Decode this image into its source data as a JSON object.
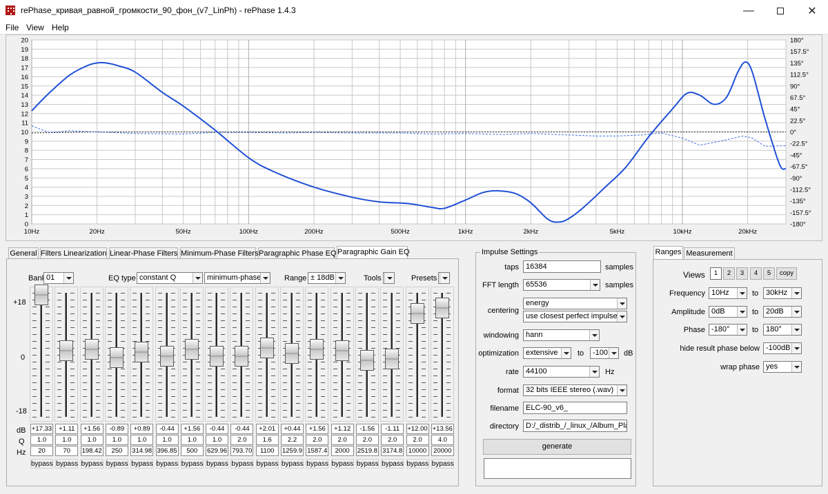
{
  "window": {
    "title": "rePhase_кривая_равной_громкости_90_фон_(v7_LinPh)  -  rePhase 1.4.3",
    "minimize_icon": "minimize-icon",
    "maximize_icon": "maximize-icon",
    "close_icon": "close-icon"
  },
  "menu": [
    "File",
    "View",
    "Help"
  ],
  "plot": {
    "y_left_ticks": [
      "20",
      "19",
      "18",
      "17",
      "16",
      "15",
      "14",
      "13",
      "12",
      "11",
      "10",
      "9",
      "8",
      "7",
      "6",
      "5",
      "4",
      "3",
      "2",
      "1",
      "0"
    ],
    "y_right_ticks": [
      "180°",
      "157.5°",
      "135°",
      "112.5°",
      "90°",
      "67.5°",
      "45°",
      "22.5°",
      "0°",
      "-22.5°",
      "-45°",
      "-67.5°",
      "-90°",
      "-112.5°",
      "-135°",
      "-157.5°",
      "-180°"
    ],
    "x_labels": [
      "10Hz",
      "20Hz",
      "50Hz",
      "100Hz",
      "200Hz",
      "500Hz",
      "1kHz",
      "2kHz",
      "5kHz",
      "10kHz",
      "20kHz"
    ],
    "colors": {
      "curve": "#1f4fd6",
      "phase": "#3d6fe0",
      "grid": "#c8c8c8",
      "background": "#ffffff"
    }
  },
  "chart_data": {
    "type": "line",
    "x_scale": "log",
    "xlim_hz": [
      10,
      30000
    ],
    "ylim_db": [
      0,
      20
    ],
    "y2lim_deg": [
      -180,
      180
    ],
    "series": [
      {
        "values_hz_db": [
          [
            10,
            12.3
          ],
          [
            12,
            14.2
          ],
          [
            15,
            16.2
          ],
          [
            18,
            17.2
          ],
          [
            20,
            17.5
          ],
          [
            22,
            17.5
          ],
          [
            25,
            17.2
          ],
          [
            30,
            16.5
          ],
          [
            40,
            14.3
          ],
          [
            50,
            12.8
          ],
          [
            70,
            10.2
          ],
          [
            100,
            7.2
          ],
          [
            130,
            5.7
          ],
          [
            200,
            4.0
          ],
          [
            300,
            2.9
          ],
          [
            400,
            2.4
          ],
          [
            550,
            2.2
          ],
          [
            700,
            1.8
          ],
          [
            800,
            1.7
          ],
          [
            1000,
            2.6
          ],
          [
            1200,
            3.4
          ],
          [
            1400,
            3.6
          ],
          [
            1700,
            3.3
          ],
          [
            2000,
            2.3
          ],
          [
            2400,
            0.5
          ],
          [
            2700,
            0.2
          ],
          [
            3000,
            0.6
          ],
          [
            3500,
            1.8
          ],
          [
            4500,
            4.2
          ],
          [
            5500,
            6.2
          ],
          [
            7000,
            9.5
          ],
          [
            9000,
            12.5
          ],
          [
            10500,
            14.2
          ],
          [
            12000,
            14.0
          ],
          [
            14000,
            13.0
          ],
          [
            16000,
            13.8
          ],
          [
            18000,
            16.5
          ],
          [
            19500,
            17.6
          ],
          [
            21000,
            16.5
          ],
          [
            24000,
            11.5
          ],
          [
            28000,
            6.5
          ],
          [
            30000,
            6.0
          ]
        ]
      },
      {
        "values_hz_deg": [
          [
            10,
            12
          ],
          [
            12,
            -1
          ],
          [
            15,
            2
          ],
          [
            20,
            0
          ],
          [
            30,
            -3
          ],
          [
            50,
            -4
          ],
          [
            70,
            -1
          ],
          [
            100,
            -1
          ],
          [
            150,
            -2
          ],
          [
            200,
            -1
          ],
          [
            300,
            -2
          ],
          [
            500,
            -2
          ],
          [
            700,
            -4
          ],
          [
            1000,
            -3
          ],
          [
            1500,
            -5
          ],
          [
            2000,
            -3
          ],
          [
            3000,
            -6
          ],
          [
            4000,
            -8
          ],
          [
            5000,
            -8
          ],
          [
            6500,
            -6
          ],
          [
            8000,
            -2
          ],
          [
            10000,
            -12
          ],
          [
            12000,
            -26
          ],
          [
            15000,
            -18
          ],
          [
            19000,
            -8
          ],
          [
            21000,
            -12
          ],
          [
            24000,
            -28
          ],
          [
            30000,
            -27
          ]
        ]
      },
      {
        "values_hz_deg": [
          [
            10,
            -2
          ],
          [
            20,
            0
          ],
          [
            50,
            0
          ],
          [
            100,
            0
          ],
          [
            200,
            0
          ],
          [
            500,
            0
          ],
          [
            1000,
            0
          ],
          [
            2000,
            0
          ],
          [
            5000,
            0
          ],
          [
            10000,
            0
          ],
          [
            20000,
            0
          ],
          [
            30000,
            0
          ]
        ]
      }
    ]
  },
  "tabs_left": [
    "General",
    "Filters Linearization",
    "Linear-Phase Filters",
    "Minimum-Phase Filters",
    "Paragraphic Phase EQ",
    "Paragraphic Gain EQ"
  ],
  "gain_eq": {
    "bank_label": "Bank",
    "bank_value": "01",
    "eq_type_label": "EQ type",
    "eq_type_value": "constant Q",
    "phase_value": "minimum-phase",
    "range_label": "Range",
    "range_value": "± 18dB",
    "tools_label": "Tools",
    "presets_label": "Presets",
    "scale_top": "+18",
    "scale_mid": "0",
    "scale_bot": "-18",
    "row_db": "dB",
    "row_q": "Q",
    "row_hz": "Hz",
    "bypass_label": "bypass",
    "bands": [
      {
        "db": "+17.33",
        "q": "1.0",
        "hz": "20",
        "gain": 17.33
      },
      {
        "db": "+1.11",
        "q": "1.0",
        "hz": "70",
        "gain": 1.11
      },
      {
        "db": "+1.56",
        "q": "1.0",
        "hz": "198.42",
        "gain": 1.56
      },
      {
        "db": "-0.89",
        "q": "1.0",
        "hz": "250",
        "gain": -0.89
      },
      {
        "db": "+0.89",
        "q": "1.0",
        "hz": "314.98",
        "gain": 0.89
      },
      {
        "db": "-0.44",
        "q": "1.0",
        "hz": "396.85",
        "gain": -0.44
      },
      {
        "db": "+1.56",
        "q": "1.0",
        "hz": "500",
        "gain": 1.56
      },
      {
        "db": "-0.44",
        "q": "1.0",
        "hz": "629.96",
        "gain": -0.44
      },
      {
        "db": "-0.44",
        "q": "2.0",
        "hz": "793.70",
        "gain": -0.44
      },
      {
        "db": "+2.01",
        "q": "1.6",
        "hz": "1100",
        "gain": 2.01
      },
      {
        "db": "+0.44",
        "q": "2.2",
        "hz": "1259.9",
        "gain": 0.44
      },
      {
        "db": "+1.56",
        "q": "2.0",
        "hz": "1587.4",
        "gain": 1.56
      },
      {
        "db": "+1.12",
        "q": "2.0",
        "hz": "2000",
        "gain": 1.12
      },
      {
        "db": "-1.56",
        "q": "2.0",
        "hz": "2519.8",
        "gain": -1.56
      },
      {
        "db": "-1.11",
        "q": "2.0",
        "hz": "3174.8",
        "gain": -1.11
      },
      {
        "db": "+12.00",
        "q": "2.0",
        "hz": "10000",
        "gain": 12.0
      },
      {
        "db": "+13.56",
        "q": "4.0",
        "hz": "20000",
        "gain": 13.56
      }
    ]
  },
  "impulse": {
    "group_title": "Impulse Settings",
    "taps_label": "taps",
    "taps_value": "16384",
    "samples_label": "samples",
    "fft_label": "FFT length",
    "fft_value": "65536",
    "centering_label": "centering",
    "centering_value": "energy",
    "centering_value2": "use closest perfect impulse",
    "windowing_label": "windowing",
    "windowing_value": "hann",
    "optimization_label": "optimization",
    "optimization_value": "extensive",
    "to_label": "to",
    "optimization_to": "-100",
    "db_label": "dB",
    "rate_label": "rate",
    "rate_value": "44100",
    "hz_label": "Hz",
    "format_label": "format",
    "format_value": "32 bits IEEE stereo (.wav)",
    "filename_label": "filename",
    "filename_value": "ELC-90_v6_",
    "directory_label": "directory",
    "directory_value": "D:/_distrib_/_linux_/Album_Player",
    "generate_label": "generate"
  },
  "ranges": {
    "tabs": [
      "Ranges",
      "Measurement"
    ],
    "views_label": "Views",
    "view_buttons": [
      "1",
      "2",
      "3",
      "4",
      "5",
      "copy"
    ],
    "frequency_label": "Frequency",
    "frequency_from": "10Hz",
    "frequency_to": "30kHz",
    "amplitude_label": "Amplitude",
    "amplitude_from": "0dB",
    "amplitude_to": "20dB",
    "phase_label": "Phase",
    "phase_from": "-180°",
    "phase_to": "180°",
    "to_label": "to",
    "hide_label": "hide result phase below",
    "hide_value": "-100dB",
    "wrap_label": "wrap phase",
    "wrap_value": "yes"
  }
}
